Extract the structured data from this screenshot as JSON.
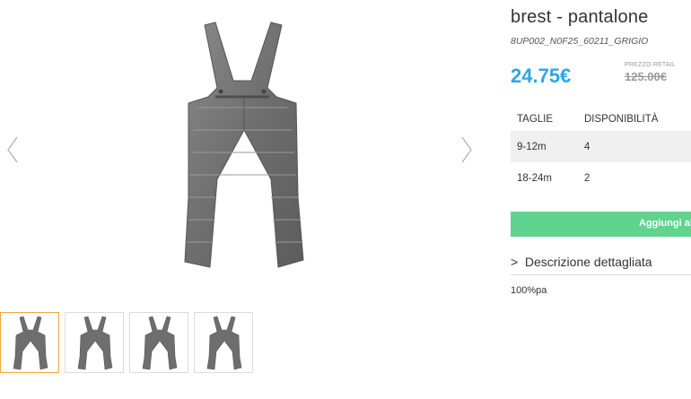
{
  "gallery": {
    "prev_icon": "chevron-left-icon",
    "next_icon": "chevron-right-icon",
    "thumbnail_count": 4,
    "active_thumbnail": 1
  },
  "product": {
    "title": "brest - pantalone",
    "sku": "8UP002_N0F25_60211_GRIGIO",
    "price": "24.75€",
    "retail_label": "PREZZO RETAIL",
    "retail_price": "125.00€",
    "price_color": "#2ea6e0"
  },
  "sizes": {
    "header_size": "TAGLIE",
    "header_availability": "DISPONIBILITÀ",
    "rows": [
      {
        "size": "9-12m",
        "availability": "4"
      },
      {
        "size": "18-24m",
        "availability": "2"
      }
    ]
  },
  "cart": {
    "label": "Aggiungi al",
    "color": "#5ed48f"
  },
  "description": {
    "toggle_label": "Descrizione dettagliata",
    "chevron": ">",
    "material": "100%pa"
  }
}
